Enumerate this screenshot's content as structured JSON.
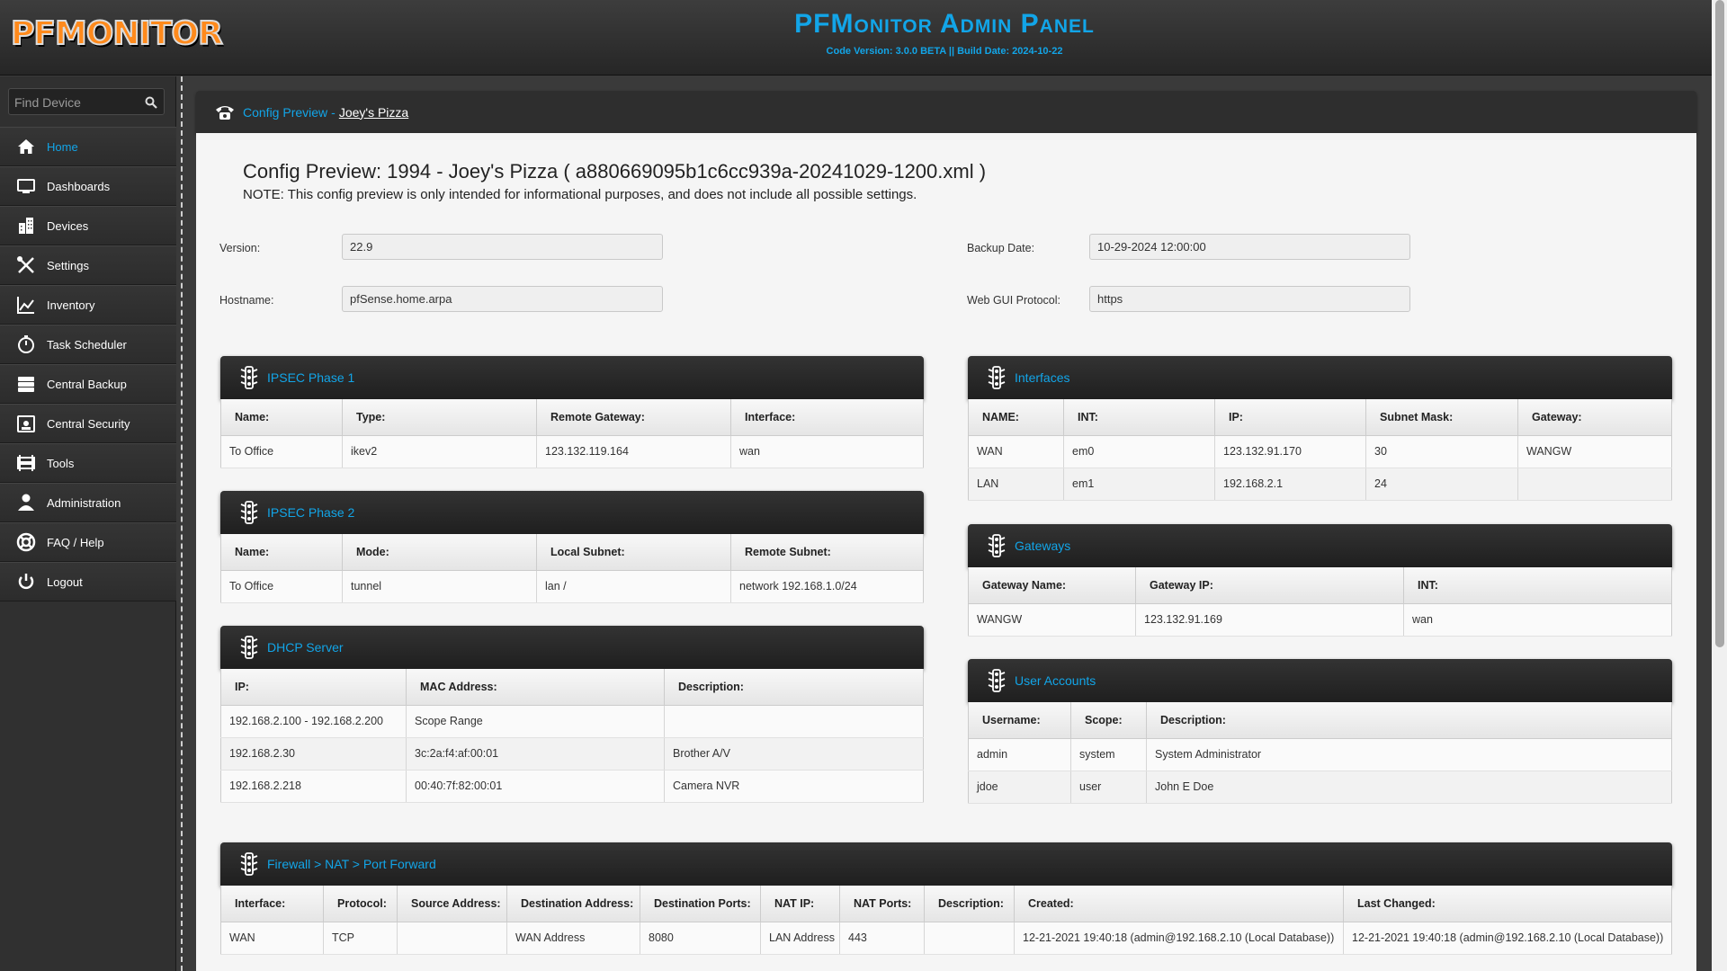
{
  "header": {
    "logo": "PFMONITOR",
    "title": "PFMonitor Admin Panel",
    "subtitle": "Code Version: 3.0.0 BETA || Build Date: 2024-10-22"
  },
  "sidebar": {
    "search_placeholder": "Find Device",
    "items": [
      {
        "label": "Home",
        "icon": "home-icon",
        "active": true
      },
      {
        "label": "Dashboards",
        "icon": "monitor-icon"
      },
      {
        "label": "Devices",
        "icon": "building-icon"
      },
      {
        "label": "Settings",
        "icon": "tools-icon"
      },
      {
        "label": "Inventory",
        "icon": "chart-line-icon"
      },
      {
        "label": "Task Scheduler",
        "icon": "stopwatch-icon"
      },
      {
        "label": "Central Backup",
        "icon": "database-icon"
      },
      {
        "label": "Central Security",
        "icon": "security-icon"
      },
      {
        "label": "Tools",
        "icon": "barrier-icon"
      },
      {
        "label": "Administration",
        "icon": "user-icon"
      },
      {
        "label": "FAQ / Help",
        "icon": "lifebuoy-icon"
      },
      {
        "label": "Logout",
        "icon": "power-icon"
      }
    ]
  },
  "breadcrumb": {
    "link": "Config Preview",
    "separator": "-",
    "current": "Joey's Pizza"
  },
  "page": {
    "heading": "Config Preview: 1994 - Joey's Pizza ( a880669095b1c6cc939a-20241029-1200.xml )",
    "note": "NOTE: This config preview is only intended for informational purposes, and does not include all possible settings."
  },
  "fields": {
    "version": {
      "label": "Version:",
      "value": "22.9"
    },
    "hostname": {
      "label": "Hostname:",
      "value": "pfSense.home.arpa"
    },
    "backup_date": {
      "label": "Backup Date:",
      "value": "10-29-2024 12:00:00"
    },
    "web_gui_protocol": {
      "label": "Web GUI Protocol:",
      "value": "https"
    }
  },
  "ipsec1": {
    "title": "IPSEC Phase 1",
    "headers": [
      "Name:",
      "Type:",
      "Remote Gateway:",
      "Interface:"
    ],
    "rows": [
      [
        "To Office",
        "ikev2",
        "123.132.119.164",
        "wan"
      ]
    ]
  },
  "ipsec2": {
    "title": "IPSEC Phase 2",
    "headers": [
      "Name:",
      "Mode:",
      "Local Subnet:",
      "Remote Subnet:"
    ],
    "rows": [
      [
        "To Office",
        "tunnel",
        "lan /",
        "network 192.168.1.0/24"
      ]
    ]
  },
  "dhcp": {
    "title": "DHCP Server",
    "headers": [
      "IP:",
      "MAC Address:",
      "Description:"
    ],
    "rows": [
      [
        "192.168.2.100 - 192.168.2.200",
        "Scope Range",
        ""
      ],
      [
        "192.168.2.30",
        "3c:2a:f4:af:00:01",
        "Brother A/V"
      ],
      [
        "192.168.2.218",
        "00:40:7f:82:00:01",
        "Camera NVR"
      ]
    ]
  },
  "interfaces": {
    "title": "Interfaces",
    "headers": [
      "NAME:",
      "INT:",
      "IP:",
      "Subnet Mask:",
      "Gateway:"
    ],
    "rows": [
      [
        "WAN",
        "em0",
        "123.132.91.170",
        "30",
        "WANGW"
      ],
      [
        "LAN",
        "em1",
        "192.168.2.1",
        "24",
        ""
      ]
    ]
  },
  "gateways": {
    "title": "Gateways",
    "headers": [
      "Gateway Name:",
      "Gateway IP:",
      "INT:"
    ],
    "rows": [
      [
        "WANGW",
        "123.132.91.169",
        "wan"
      ]
    ]
  },
  "users": {
    "title": "User Accounts",
    "headers": [
      "Username:",
      "Scope:",
      "Description:"
    ],
    "rows": [
      [
        "admin",
        "system",
        "System Administrator"
      ],
      [
        "jdoe",
        "user",
        "John E Doe"
      ]
    ]
  },
  "nat": {
    "title": "Firewall > NAT > Port Forward",
    "headers": [
      "Interface:",
      "Protocol:",
      "Source Address:",
      "Destination Address:",
      "Destination Ports:",
      "NAT IP:",
      "NAT Ports:",
      "Description:",
      "Created:",
      "Last Changed:"
    ],
    "rows": [
      [
        "WAN",
        "TCP",
        "",
        "WAN Address",
        "8080",
        "LAN Address",
        "443",
        "",
        "12-21-2021 19:40:18 (admin@192.168.2.10 (Local Database))",
        "12-21-2021 19:40:18 (admin@192.168.2.10 (Local Database))"
      ]
    ]
  }
}
